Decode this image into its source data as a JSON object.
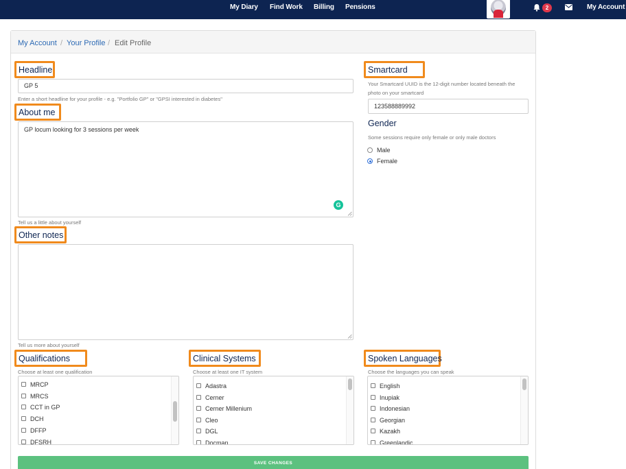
{
  "nav": {
    "links": [
      "My Diary",
      "Find Work",
      "Billing",
      "Pensions"
    ],
    "notification_count": "2",
    "account_label": "My Account"
  },
  "breadcrumb": {
    "items": [
      "My Account",
      "Your Profile",
      "Edit Profile"
    ],
    "separator": "/"
  },
  "headline": {
    "title": "Headline",
    "value": "GP 5",
    "hint": "Enter a short headline for your profile - e.g. \"Portfolio GP\" or \"GPSI interested in diabetes\""
  },
  "about": {
    "title": "About me",
    "value": "GP locum looking for 3 sessions per week",
    "hint": "Tell us a little about yourself"
  },
  "other_notes": {
    "title": "Other notes",
    "value": "",
    "hint": "Tell us more about yourself"
  },
  "smartcard": {
    "title": "Smartcard",
    "hint_line1": "Your Smartcard UUID is the 12-digit number located beneath the",
    "hint_line2": "photo on your smartcard",
    "value": "123588889992"
  },
  "gender": {
    "title": "Gender",
    "hint": "Some sessions require only female or only male doctors",
    "options": [
      "Male",
      "Female"
    ],
    "selected": "Female"
  },
  "qualifications": {
    "title": "Qualifications",
    "hint": "Choose at least one qualification",
    "items": [
      "MRCP",
      "MRCS",
      "CCT in GP",
      "DCH",
      "DFFP",
      "DFSRH"
    ]
  },
  "clinical_systems": {
    "title": "Clinical Systems",
    "hint": "Choose at least one IT system",
    "items": [
      "Adastra",
      "Cerner",
      "Cerner Millenium",
      "Cleo",
      "DGL",
      "Docman"
    ]
  },
  "spoken_languages": {
    "title": "Spoken Languages",
    "hint": "Choose the languages you can speak",
    "items": [
      "English",
      "Inupiak",
      "Indonesian",
      "Georgian",
      "Kazakh",
      "Greenlandic"
    ]
  },
  "save_label": "SAVE CHANGES",
  "colors": {
    "nav_bg": "#0d2451",
    "highlight": "#f08a1c",
    "save_button": "#5cc17f",
    "link": "#2d6ab4",
    "badge": "#e0384b"
  }
}
